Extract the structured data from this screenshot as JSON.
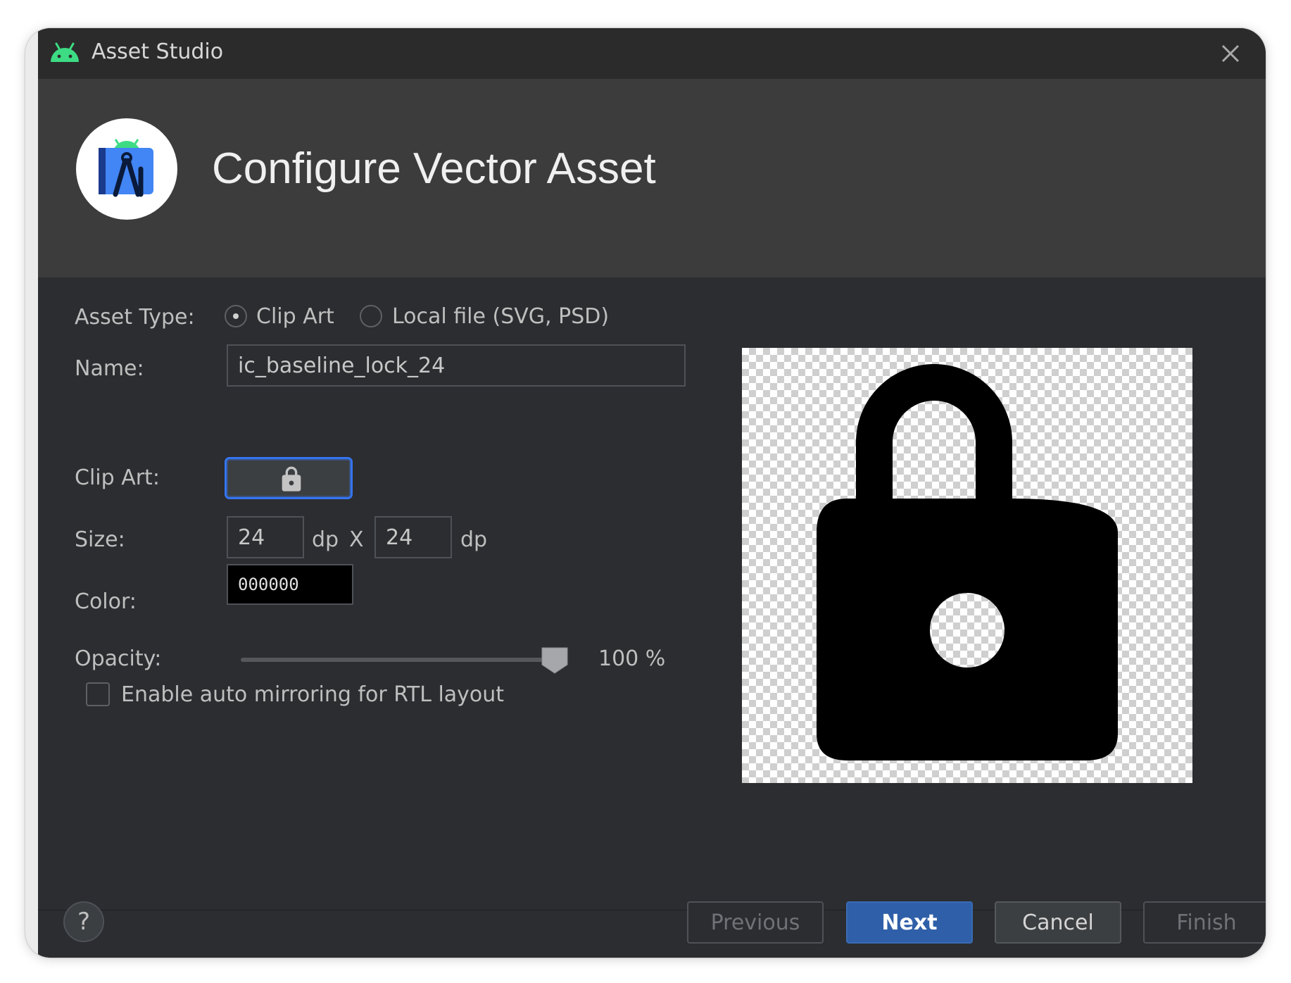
{
  "window": {
    "title": "Asset Studio"
  },
  "header": {
    "title": "Configure Vector Asset"
  },
  "form": {
    "asset_type_label": "Asset Type:",
    "asset_type_options": [
      {
        "label": "Clip Art",
        "selected": true
      },
      {
        "label": "Local file (SVG, PSD)",
        "selected": false
      }
    ],
    "name_label": "Name:",
    "name_value": "ic_baseline_lock_24",
    "clip_art_label": "Clip Art:",
    "clip_art_icon": "lock-icon",
    "size_label": "Size:",
    "width_value": "24",
    "width_unit": "dp",
    "size_separator": "X",
    "height_value": "24",
    "height_unit": "dp",
    "color_label": "Color:",
    "color_value": "000000",
    "opacity_label": "Opacity:",
    "opacity_value": 1.0,
    "opacity_text": "100 %",
    "auto_mirror_label": "Enable auto mirroring for RTL layout",
    "auto_mirror_checked": false
  },
  "preview": {
    "icon": "lock-icon",
    "icon_color": "#000000"
  },
  "footer": {
    "help_label": "?",
    "previous_label": "Previous",
    "next_label": "Next",
    "cancel_label": "Cancel",
    "finish_label": "Finish"
  },
  "colors": {
    "primary_button": "#2f5fa8",
    "focus_accent": "#3574f0",
    "android_green": "#3ddc84"
  }
}
